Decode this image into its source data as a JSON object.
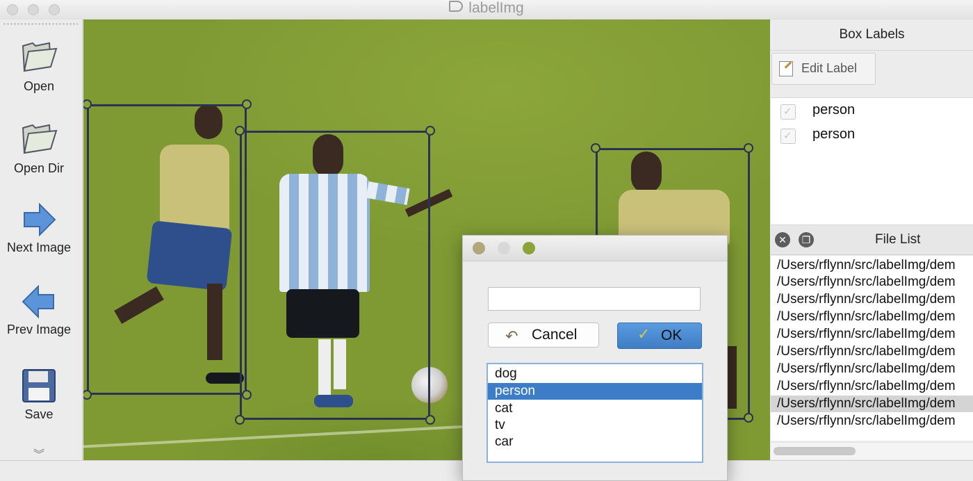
{
  "window": {
    "title": "labelImg",
    "title_icon": "tag-icon"
  },
  "toolbar": {
    "items": [
      {
        "label": "Open",
        "icon": "folder-open-icon"
      },
      {
        "label": "Open Dir",
        "icon": "folder-open-icon"
      },
      {
        "label": "Next Image",
        "icon": "arrow-right-icon"
      },
      {
        "label": "Prev Image",
        "icon": "arrow-left-icon"
      },
      {
        "label": "Save",
        "icon": "floppy-disk-icon"
      }
    ],
    "more_icon": "double-chevron-down-icon"
  },
  "box_labels": {
    "title": "Box Labels",
    "edit_label_button": "Edit Label",
    "items": [
      {
        "label": "person",
        "checked": true
      },
      {
        "label": "person",
        "checked": true
      }
    ]
  },
  "file_list": {
    "title": "File List",
    "items": [
      "/Users/rflynn/src/labelImg/dem",
      "/Users/rflynn/src/labelImg/dem",
      "/Users/rflynn/src/labelImg/dem",
      "/Users/rflynn/src/labelImg/dem",
      "/Users/rflynn/src/labelImg/dem",
      "/Users/rflynn/src/labelImg/dem",
      "/Users/rflynn/src/labelImg/dem",
      "/Users/rflynn/src/labelImg/dem",
      "/Users/rflynn/src/labelImg/dem",
      "/Users/rflynn/src/labelImg/dem"
    ],
    "selected_index": 8
  },
  "dialog": {
    "input_value": "",
    "cancel_label": "Cancel",
    "ok_label": "OK",
    "options": [
      "dog",
      "person",
      "cat",
      "tv",
      "car"
    ],
    "selected_option": "person"
  },
  "colors": {
    "bbox_stroke": "#2b3350",
    "selection_blue": "#3d7dc8",
    "ok_button": "#4a8bd3"
  }
}
